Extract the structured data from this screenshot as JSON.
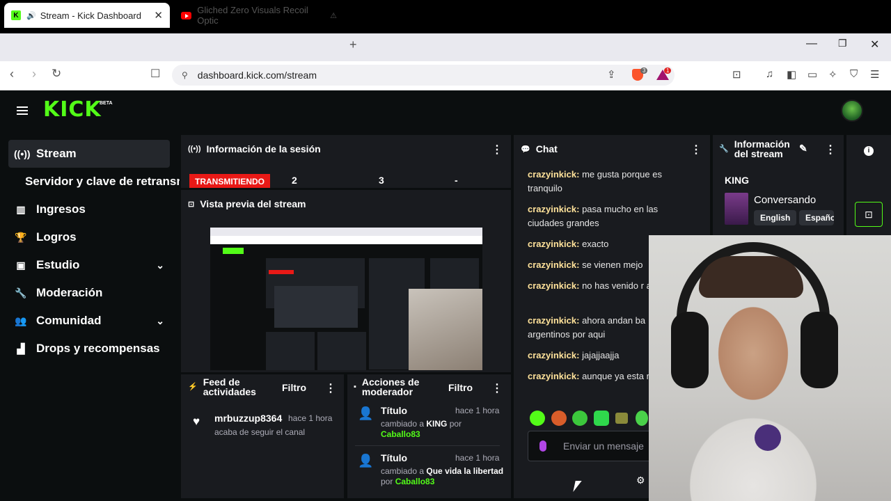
{
  "browser": {
    "active_tab": {
      "title": "Stream - Kick Dashboard"
    },
    "inactive_tab": {
      "title": "Gliched Zero Visuals Recoil Optic"
    },
    "url": "dashboard.kick.com/stream",
    "brave_badge": "3",
    "rewards_badge": "1"
  },
  "app": {
    "logo": "KICK",
    "logo_badge": "BETA",
    "brand_color": "#53fc18"
  },
  "sidebar": {
    "items": [
      {
        "label": "Stream",
        "icon": "broadcast-icon"
      },
      {
        "label": "Servidor y clave de retransmisión"
      },
      {
        "label": "Ingresos",
        "icon": "bar-chart-icon"
      },
      {
        "label": "Logros",
        "icon": "trophy-icon"
      },
      {
        "label": "Estudio",
        "icon": "studio-icon"
      },
      {
        "label": "Moderación",
        "icon": "wrench-icon"
      },
      {
        "label": "Comunidad",
        "icon": "community-icon"
      },
      {
        "label": "Drops y recompensas",
        "icon": "drops-icon"
      }
    ]
  },
  "session": {
    "title": "Información de la sesión",
    "status": "TRANSMITIENDO",
    "stat1": "2",
    "stat2": "3",
    "stat3": "-"
  },
  "preview": {
    "title": "Vista previa del stream"
  },
  "feed": {
    "title_line1": "Feed de",
    "title_line2": "actividades",
    "filter": "Filtro",
    "user": "mrbuzzup8364",
    "time": "hace 1 hora",
    "action": "acaba de seguir el canal"
  },
  "mod": {
    "title_line1": "Acciones de",
    "title_line2": "moderador",
    "filter": "Filtro",
    "items": [
      {
        "title": "Título",
        "time": "hace 1 hora",
        "pre": "cambiado a",
        "value": "KING",
        "by": "por",
        "user": "Caballo83"
      },
      {
        "title": "Título",
        "time": "hace 1 hora",
        "pre": "cambiado a",
        "value": "Que vida la libertad",
        "by": "por",
        "user": "Caballo83"
      }
    ]
  },
  "chat": {
    "title": "Chat",
    "messages": [
      {
        "user": "crazyinkick:",
        "text": "me gusta porque es tranquilo"
      },
      {
        "user": "crazyinkick:",
        "text": "pasa mucho en las ciudades grandes"
      },
      {
        "user": "crazyinkick:",
        "text": "exacto"
      },
      {
        "user": "crazyinkick:",
        "text": "se vienen mejo"
      },
      {
        "user": "crazyinkick:",
        "text": "no has venido r aqui?"
      },
      {
        "user": "crazyinkick:",
        "text": "ahora andan ba argentinos por aqui"
      },
      {
        "user": "crazyinkick:",
        "text": "jajajjaajja"
      },
      {
        "user": "crazyinkick:",
        "text": "aunque ya esta retiro"
      }
    ],
    "input_placeholder": "Enviar un mensaje"
  },
  "stream_info": {
    "title_line1": "Información",
    "title_line2": "del stream",
    "stream_title": "KING",
    "category": "Conversando",
    "tags": [
      "English",
      "Español"
    ]
  }
}
